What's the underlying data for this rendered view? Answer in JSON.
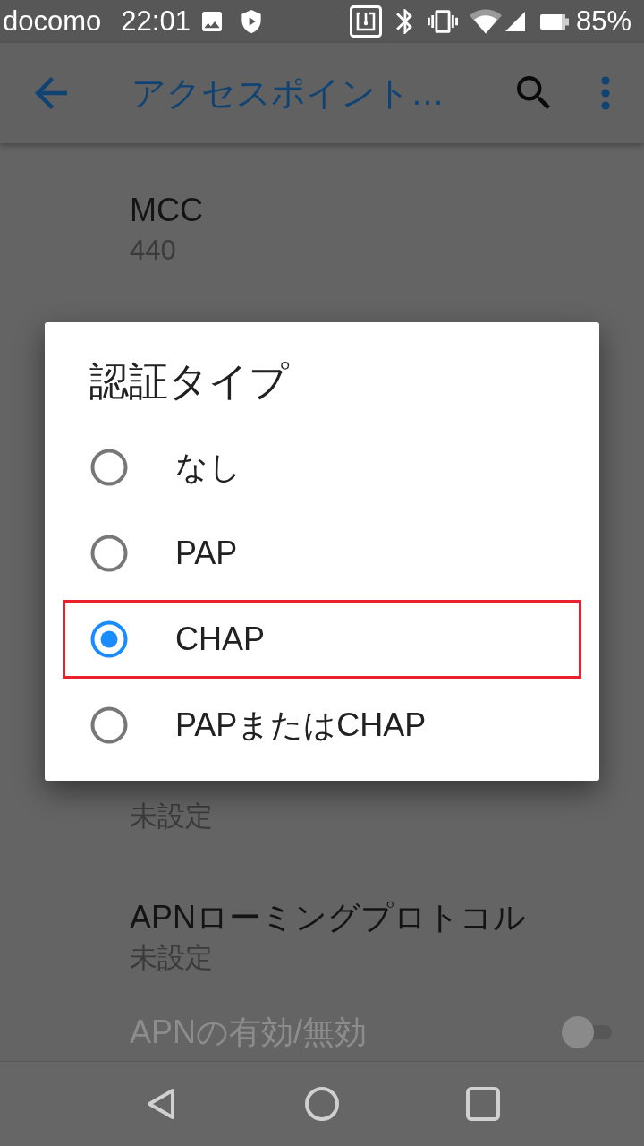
{
  "status_bar": {
    "carrier": "docomo",
    "time": "22:01",
    "battery": "85%"
  },
  "app_bar": {
    "title": "アクセスポイント…"
  },
  "settings_list": [
    {
      "kind": "text",
      "title": "MCC",
      "summary": "440",
      "disabled": false
    },
    {
      "kind": "text",
      "summary": "未設定",
      "disabled": false
    },
    {
      "kind": "text",
      "title": "APNローミングプロトコル",
      "summary": "未設定",
      "disabled": false
    },
    {
      "kind": "switch",
      "title": "APNの有効/無効",
      "disabled": true,
      "on": false
    }
  ],
  "dialog": {
    "title": "認証タイプ",
    "options": [
      {
        "label": "なし",
        "selected": false,
        "highlighted": false
      },
      {
        "label": "PAP",
        "selected": false,
        "highlighted": false
      },
      {
        "label": "CHAP",
        "selected": true,
        "highlighted": true
      },
      {
        "label": "PAPまたはCHAP",
        "selected": false,
        "highlighted": false
      }
    ]
  }
}
